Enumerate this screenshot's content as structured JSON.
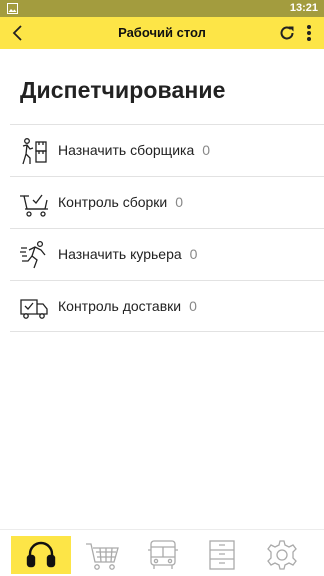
{
  "status_bar": {
    "time": "13:21",
    "icon": "gallery-icon",
    "background": "#a39c3e"
  },
  "toolbar": {
    "title": "Рабочий стол",
    "back_icon": "chevron-left-icon",
    "refresh_icon": "refresh-icon",
    "menu_icon": "more-vertical-icon",
    "background": "#fde547"
  },
  "heading": "Диспетчирование",
  "items": [
    {
      "label": "Назначить сборщика",
      "count": "0",
      "icon": "assign-picker-icon"
    },
    {
      "label": "Контроль сборки",
      "count": "0",
      "icon": "cart-check-icon"
    },
    {
      "label": "Назначить курьера",
      "count": "0",
      "icon": "runner-icon"
    },
    {
      "label": "Контроль доставки",
      "count": "0",
      "icon": "truck-check-icon"
    }
  ],
  "bottom_nav": [
    {
      "icon": "headset-icon",
      "active": true
    },
    {
      "icon": "cart-icon",
      "active": false
    },
    {
      "icon": "bus-icon",
      "active": false
    },
    {
      "icon": "cabinet-icon",
      "active": false
    },
    {
      "icon": "gear-icon",
      "active": false
    }
  ],
  "colors": {
    "accent": "#fde547",
    "text": "#222222",
    "muted": "#888888"
  }
}
